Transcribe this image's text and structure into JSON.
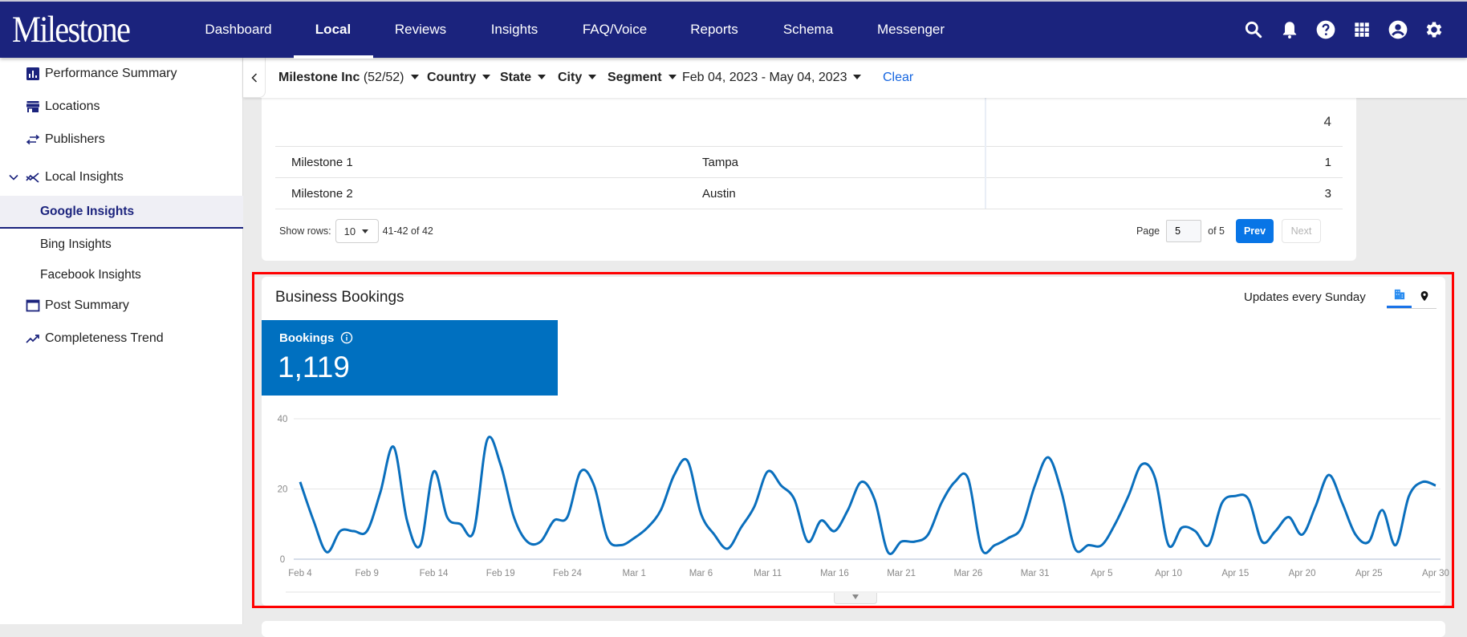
{
  "header": {
    "logo": "Milestone",
    "nav": [
      {
        "label": "Dashboard",
        "active": false
      },
      {
        "label": "Local",
        "active": true
      },
      {
        "label": "Reviews",
        "active": false
      },
      {
        "label": "Insights",
        "active": false
      },
      {
        "label": "FAQ/Voice",
        "active": false
      },
      {
        "label": "Reports",
        "active": false
      },
      {
        "label": "Schema",
        "active": false
      },
      {
        "label": "Messenger",
        "active": false
      }
    ],
    "icons": [
      "search-icon",
      "bell-icon",
      "help-icon",
      "apps-grid-icon",
      "account-icon",
      "settings-gear-icon"
    ]
  },
  "sidebar": {
    "items": [
      {
        "label": "Performance Summary",
        "icon": "bar-chart-icon"
      },
      {
        "label": "Locations",
        "icon": "store-icon"
      },
      {
        "label": "Publishers",
        "icon": "swap-arrows-icon"
      },
      {
        "label": "Local Insights",
        "icon": "insights-trend-icon",
        "expanded": true
      },
      {
        "label": "Google Insights",
        "sub": true,
        "active": true
      },
      {
        "label": "Bing Insights",
        "sub": true
      },
      {
        "label": "Facebook Insights",
        "sub": true
      },
      {
        "label": "Post Summary",
        "icon": "window-icon"
      },
      {
        "label": "Completeness Trend",
        "icon": "trending-up-icon"
      }
    ]
  },
  "filters": {
    "account": "Milestone Inc",
    "account_count": "(52/52)",
    "country": "Country",
    "state": "State",
    "city": "City",
    "segment": "Segment",
    "date_range": "Feb 04, 2023 - May 04, 2023",
    "clear": "Clear"
  },
  "table": {
    "header_total": "4",
    "rows": [
      {
        "name": "Milestone 1",
        "city": "Tampa",
        "value": "1"
      },
      {
        "name": "Milestone 2",
        "city": "Austin",
        "value": "3"
      }
    ],
    "show_rows_label": "Show rows:",
    "rows_per_page": "10",
    "range_text": "41-42 of 42",
    "page_label": "Page",
    "page_value": "5",
    "page_of": "of 5",
    "prev": "Prev",
    "next": "Next"
  },
  "bookings": {
    "title": "Business Bookings",
    "updates_text": "Updates every Sunday",
    "kpi_label": "Bookings",
    "kpi_value": "1,119",
    "accent_color": "#0070c0",
    "line_color": "#0a6fbd"
  },
  "chart_data": {
    "type": "line",
    "title": "Business Bookings",
    "xlabel": "",
    "ylabel": "",
    "ylim": [
      0,
      40
    ],
    "yticks": [
      0,
      20,
      40
    ],
    "grid": true,
    "legend": "none",
    "start_date": "Feb 4",
    "xtick_labels": [
      "Feb 4",
      "Feb 9",
      "Feb 14",
      "Feb 19",
      "Feb 24",
      "Mar 1",
      "Mar 6",
      "Mar 11",
      "Mar 16",
      "Mar 21",
      "Mar 26",
      "Mar 31",
      "Apr 5",
      "Apr 10",
      "Apr 15",
      "Apr 20",
      "Apr 25",
      "Apr 30"
    ],
    "xtick_every_days": 5,
    "series": [
      {
        "name": "Bookings",
        "values": [
          22,
          11,
          2,
          8,
          8,
          8,
          19,
          32,
          11,
          4,
          25,
          12,
          10,
          8,
          34,
          27,
          12,
          5,
          5,
          11,
          12,
          25,
          21,
          6,
          4,
          6,
          9,
          14,
          24,
          28,
          13,
          7,
          3,
          9,
          15,
          25,
          21,
          17,
          5,
          11,
          8,
          14,
          22,
          17,
          2,
          5,
          5,
          7,
          16,
          22,
          23,
          3,
          4,
          6,
          9,
          21,
          29,
          19,
          3,
          4,
          4,
          10,
          18,
          27,
          23,
          4,
          9,
          8,
          4,
          16,
          18,
          17,
          5,
          8,
          12,
          7,
          15,
          24,
          16,
          7,
          5,
          14,
          4,
          18,
          22,
          21
        ]
      }
    ]
  }
}
